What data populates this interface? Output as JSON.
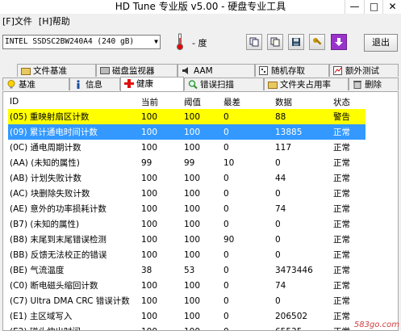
{
  "window": {
    "title": "HD Tune 专业版 v5.00 - 硬盘专业工具"
  },
  "menu": {
    "file": "[F]文件",
    "help": "[H]帮助"
  },
  "toolbar": {
    "drive": "INTEL SSDSC2BW240A4 (240 gB)",
    "temperature": "- 度",
    "exit_label": "退出"
  },
  "tabs_top": [
    "文件基准",
    "磁盘监视器",
    "AAM",
    "随机存取",
    "额外测试"
  ],
  "tabs_bottom": [
    "基准",
    "信息",
    "健康",
    "错误扫描",
    "文件夹占用率",
    "删除"
  ],
  "table": {
    "headers": [
      "ID",
      "当前",
      "阈值",
      "最差",
      "数据",
      "状态"
    ],
    "rows": [
      [
        "(05) 重映射扇区计数",
        "100",
        "100",
        "0",
        "88",
        "警告"
      ],
      [
        "(09) 累计通电时间计数",
        "100",
        "100",
        "0",
        "13885",
        "正常"
      ],
      [
        "(0C) 通电周期计数",
        "100",
        "100",
        "0",
        "117",
        "正常"
      ],
      [
        "(AA) (未知的属性)",
        "99",
        "99",
        "10",
        "0",
        "正常"
      ],
      [
        "(AB) 计划失败计数",
        "100",
        "100",
        "0",
        "44",
        "正常"
      ],
      [
        "(AC) 块删除失败计数",
        "100",
        "100",
        "0",
        "0",
        "正常"
      ],
      [
        "(AE) 意外的功率损耗计数",
        "100",
        "100",
        "0",
        "74",
        "正常"
      ],
      [
        "(B7) (未知的属性)",
        "100",
        "100",
        "0",
        "0",
        "正常"
      ],
      [
        "(B8) 末尾到末尾错误检测",
        "100",
        "100",
        "90",
        "0",
        "正常"
      ],
      [
        "(BB) 反馈无法校正的错误",
        "100",
        "100",
        "0",
        "0",
        "正常"
      ],
      [
        "(BE) 气流温度",
        "38",
        "53",
        "0",
        "3473446",
        "正常"
      ],
      [
        "(C0) 断电磁头缩回计数",
        "100",
        "100",
        "0",
        "74",
        "正常"
      ],
      [
        "(C7) Ultra DMA CRC 错误计数",
        "100",
        "100",
        "0",
        "0",
        "正常"
      ],
      [
        "(E1) 主区域写入",
        "100",
        "100",
        "0",
        "206502",
        "正常"
      ],
      [
        "(E2) 磁头伸出时间",
        "100",
        "100",
        "0",
        "65535",
        "正常"
      ]
    ]
  },
  "watermark": "583go.com"
}
